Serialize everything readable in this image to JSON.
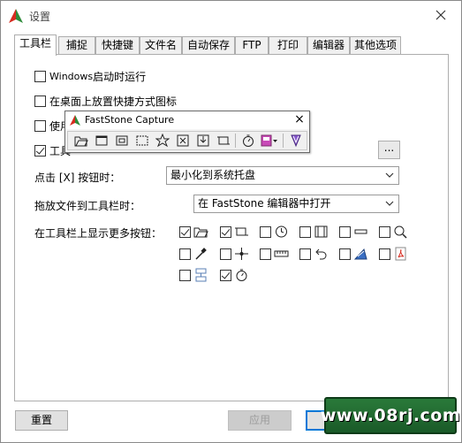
{
  "window": {
    "title": "设置"
  },
  "tabs": [
    {
      "label": "工具栏",
      "active": true
    },
    {
      "label": "捕捉"
    },
    {
      "label": "快捷键"
    },
    {
      "label": "文件名"
    },
    {
      "label": "自动保存"
    },
    {
      "label": "FTP"
    },
    {
      "label": "打印"
    },
    {
      "label": "编辑器"
    },
    {
      "label": "其他选项"
    }
  ],
  "options": {
    "windows_autostart": {
      "prefix": "Windows",
      "suffix": " 启动时运行",
      "checked": false
    },
    "desktop_shortcut": {
      "label": "在桌面上放置快捷方式图标",
      "checked": false
    },
    "use_prefix": {
      "label": "使用",
      "checked": false
    },
    "toolbar_prefix": {
      "label": "工具",
      "checked": true
    }
  },
  "browse_button": "...",
  "close_action": {
    "label": "点击 [X] 按钮时：",
    "value": "最小化到系统托盘"
  },
  "drag_action": {
    "label": "拖放文件到工具栏时：",
    "value": "在 FastStone 编辑器中打开"
  },
  "more_buttons": {
    "label": "在工具栏上显示更多按钮：",
    "items": [
      {
        "icon": "open-folder-icon",
        "checked": true
      },
      {
        "icon": "crop-icon",
        "checked": true
      },
      {
        "icon": "clock-icon",
        "checked": false
      },
      {
        "icon": "film-icon",
        "checked": false
      },
      {
        "icon": "minimize-bar-icon",
        "checked": false
      },
      {
        "icon": "magnifier-icon",
        "checked": false
      },
      {
        "icon": "color-picker-icon",
        "checked": false
      },
      {
        "icon": "crosshair-icon",
        "checked": false
      },
      {
        "icon": "ruler-icon",
        "checked": false
      },
      {
        "icon": "undo-icon",
        "checked": false
      },
      {
        "icon": "draw-icon",
        "checked": false
      },
      {
        "icon": "pdf-icon",
        "checked": false
      },
      {
        "icon": "split-screen-icon",
        "checked": false
      },
      {
        "icon": "timer-icon",
        "checked": true
      }
    ]
  },
  "floating_toolbar": {
    "title": "FastStone Capture",
    "close": "×",
    "tools": [
      "open-icon",
      "active-window-icon",
      "window-object-icon",
      "rectangle-region-icon",
      "freehand-region-icon",
      "fullscreen-icon",
      "scrolling-window-icon",
      "fixed-region-icon",
      "delay-timer-icon",
      "output-icon",
      "settings-icon"
    ]
  },
  "buttons": {
    "reset": "重置",
    "apply": "应用"
  },
  "watermark": "www.08rj.com",
  "colors": {
    "accent": "#0078d7",
    "logo_red": "#d62b1f",
    "logo_green": "#2e8b3a"
  }
}
